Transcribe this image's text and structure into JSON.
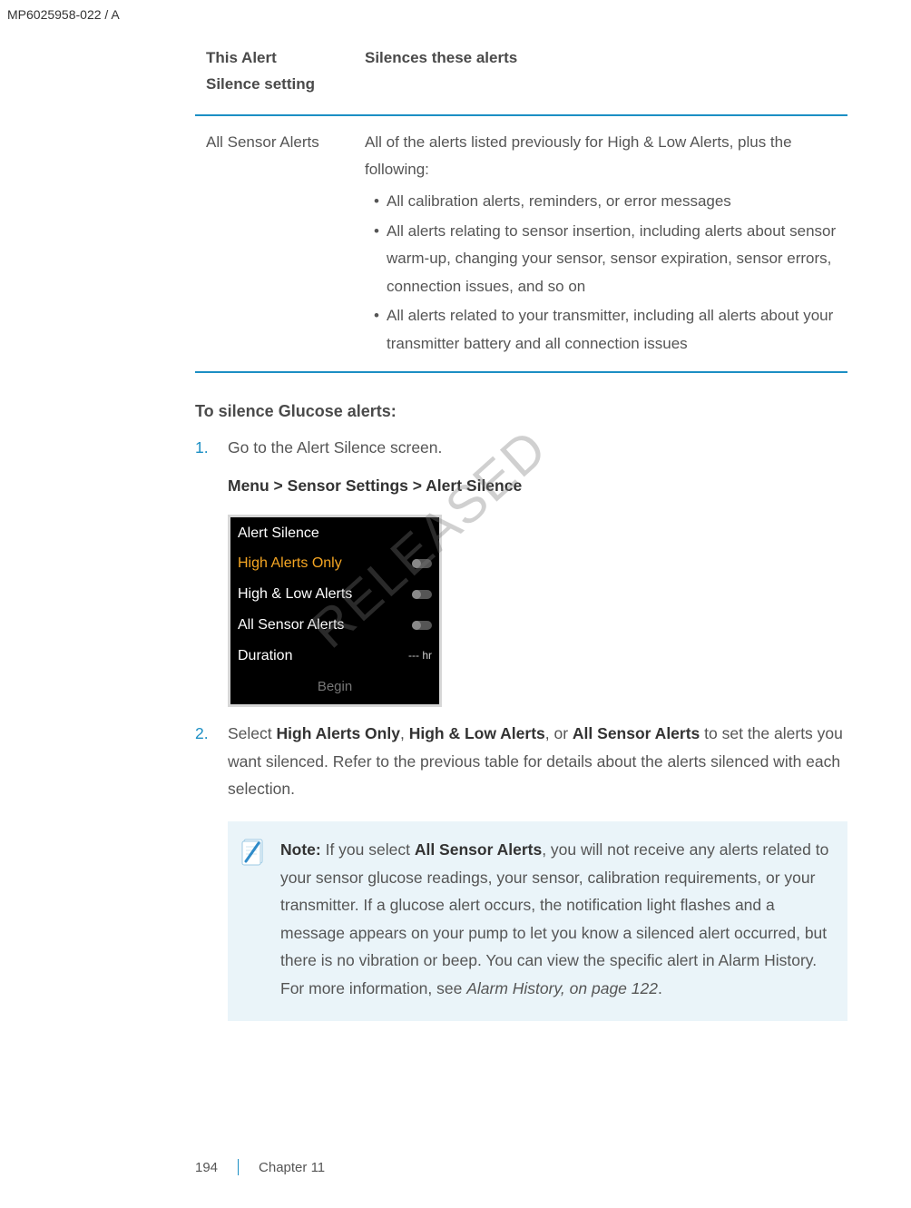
{
  "doc_id": "MP6025958-022 / A",
  "table": {
    "header_col1_line1": "This Alert",
    "header_col1_line2": "Silence setting",
    "header_col2": "Silences these alerts",
    "row1_col1": "All Sensor Alerts",
    "row1_intro": "All of the alerts listed previously for High & Low Alerts, plus the following:",
    "row1_items": [
      "All calibration alerts, reminders, or error messages",
      "All alerts relating to sensor insertion, including alerts about sensor warm-up, changing your sensor, sensor expiration, sensor errors, connection issues, and so on",
      "All alerts related to your transmitter, including all alerts about your transmitter battery and all connection issues"
    ]
  },
  "section_heading": "To silence Glucose alerts:",
  "steps": {
    "s1_text": "Go to the Alert Silence screen.",
    "s1_path_a": "Menu > ",
    "s1_path_b": "Sensor Settings > ",
    "s1_path_c": "Alert Silence",
    "s2_prefix": "Select ",
    "s2_b1": "High Alerts Only",
    "s2_mid1": ", ",
    "s2_b2": "High & Low Alerts",
    "s2_mid2": ", or ",
    "s2_b3": "All Sensor Alerts",
    "s2_rest": " to set the alerts you want silenced. Refer to the previous table for details about the alerts silenced with each selection."
  },
  "device": {
    "title": "Alert Silence",
    "opt1": "High Alerts Only",
    "opt2": "High & Low Alerts",
    "opt3": "All Sensor Alerts",
    "duration_label": "Duration",
    "duration_value": "--- hr",
    "begin": "Begin"
  },
  "note": {
    "label": "Note:  ",
    "p1": "If you select ",
    "b1": "All Sensor Alerts",
    "p2": ", you will not receive any alerts related to your sensor glucose readings, your sensor, calibration requirements, or your transmitter. If a glucose alert occurs, the notification light flashes and a message appears on your pump to let you know a silenced alert occurred, but there is no vibration or beep. You can view the specific alert in Alarm History. For more information, see ",
    "italic": "Alarm History, on page 122",
    "p3": "."
  },
  "watermark": "RELEASED",
  "footer": {
    "page": "194",
    "chapter": "Chapter 11"
  }
}
